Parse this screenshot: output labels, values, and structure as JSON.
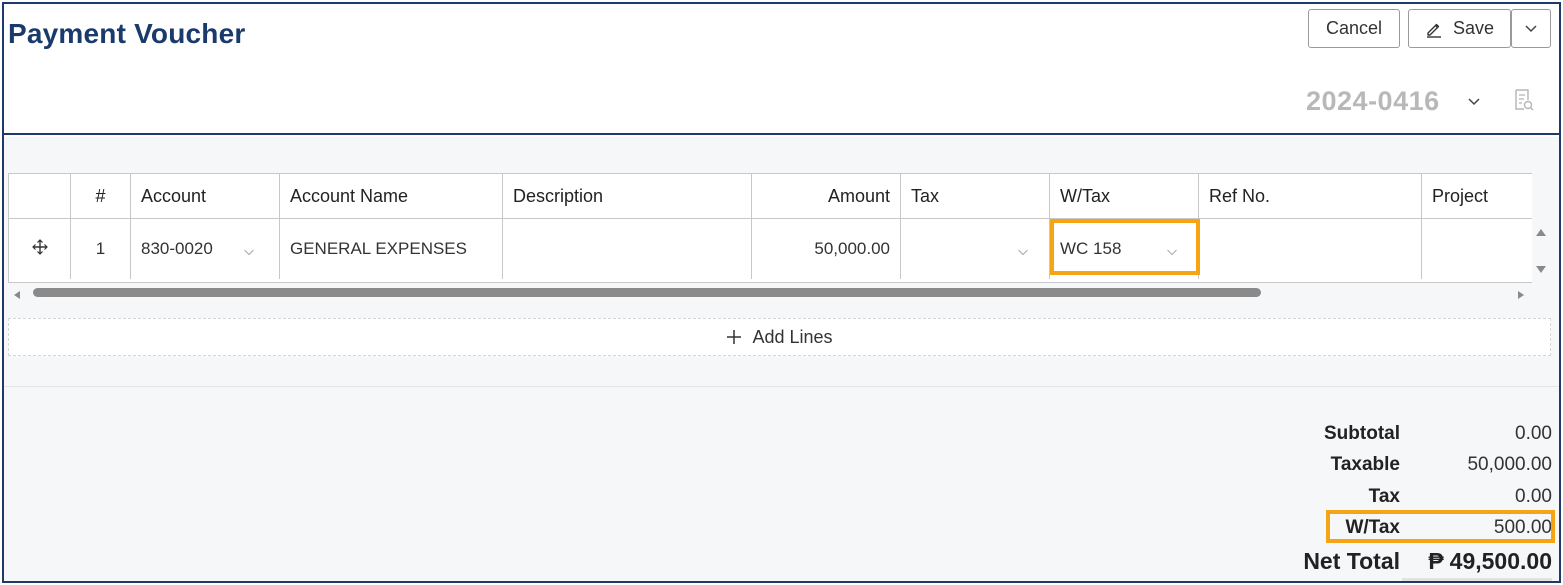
{
  "header": {
    "title": "Payment Voucher",
    "cancel_label": "Cancel",
    "save_label": "Save",
    "document_number": "2024-0416"
  },
  "grid": {
    "columns": [
      "#",
      "Account",
      "Account Name",
      "Description",
      "Amount",
      "Tax",
      "W/Tax",
      "Ref No.",
      "Project"
    ],
    "rows": [
      {
        "number": "1",
        "account": "830-0020",
        "account_name": "GENERAL EXPENSES",
        "description": "",
        "amount": "50,000.00",
        "tax": "",
        "wtax": "WC 158",
        "ref_no": "",
        "project": ""
      }
    ]
  },
  "add_lines_label": "Add Lines",
  "totals": {
    "subtotal_label": "Subtotal",
    "subtotal_value": "0.00",
    "taxable_label": "Taxable",
    "taxable_value": "50,000.00",
    "tax_label": "Tax",
    "tax_value": "0.00",
    "wtax_label": "W/Tax",
    "wtax_value": "500.00",
    "net_label": "Net Total",
    "currency_symbol": "₱",
    "net_value": "49,500.00"
  },
  "colors": {
    "title": "#1a3a6c",
    "frame_border": "#1d3a6b",
    "highlight": "#f5a413",
    "doc_number": "#b8b8b8"
  },
  "icons": {
    "save": "pencil-icon",
    "more": "chevron-down-icon",
    "doc_search": "document-search-icon",
    "drag": "move-handle-icon",
    "add": "plus-icon"
  }
}
